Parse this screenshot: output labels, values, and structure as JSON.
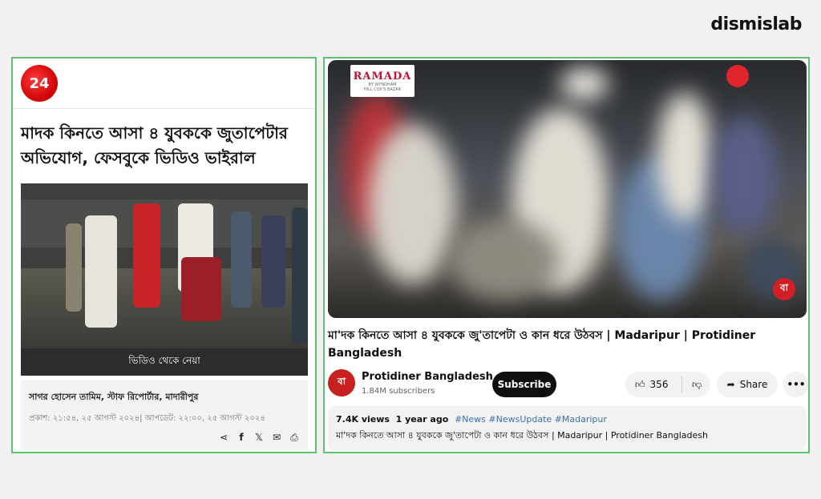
{
  "brand": {
    "name": "dismislab"
  },
  "left": {
    "channel_logo_text": "24",
    "title": "মাদক কিনতে আসা ৪ যুবককে জুতাপেটার অভিযোগ, ফেসবুকে ভিডিও ভাইরাল",
    "photo_caption": "ভিডিও থেকে নেয়া",
    "byline": "সাগর হোসেন তামিম, স্টাফ রিপোর্টার, মাদারীপুর",
    "published": "প্রকাশ: ২১:৫৪, ২৫ আগস্ট ২০২৪| আপডেট: ২২:০০, ২৫ আগস্ট ২০২৪",
    "share_icons": [
      "share-icon",
      "facebook-icon",
      "x-icon",
      "mail-icon",
      "print-icon"
    ]
  },
  "right": {
    "watermark": {
      "name": "RAMADA",
      "line2": "BY WYNDHAM",
      "line3": "HILL COX'S BAZAR"
    },
    "channel_badge": "বা",
    "title": "মা'দক কিনতে আসা ৪ যুবককে জু'তাপেটা ও কান ধরে উঠবস | Madaripur | Protidiner Bangladesh",
    "channel": {
      "avatar_text": "বা",
      "name": "Protidiner Bangladesh",
      "subscribers": "1.84M subscribers"
    },
    "subscribe_label": "Subscribe",
    "likes": "356",
    "share_label": "Share",
    "more_label": "•••",
    "description": {
      "views": "7.4K views",
      "age": "1 year ago",
      "tags": "#News #NewsUpdate #Madaripur",
      "text": "মা'দক কিনতে আসা ৪ যুবককে জু'তাপেটা ও কান ধরে উঠবস | Madaripur | Protidiner Bangladesh"
    }
  }
}
